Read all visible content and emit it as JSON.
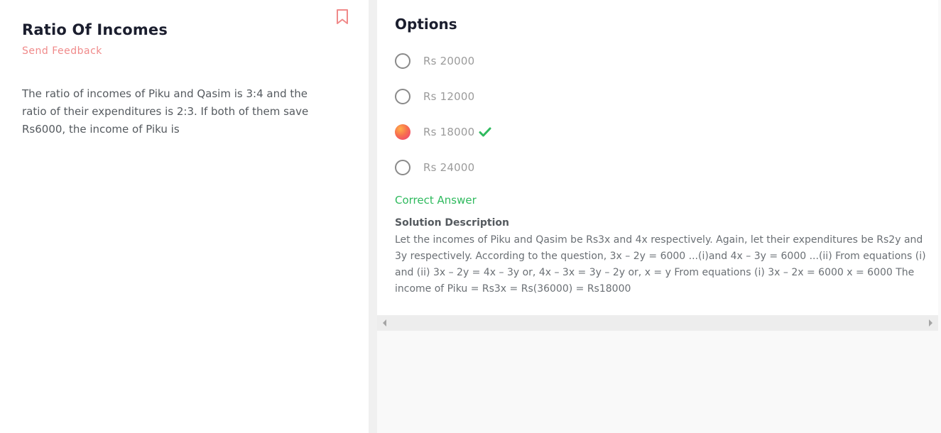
{
  "question": {
    "title": "Ratio Of Incomes",
    "feedback_label": "Send Feedback",
    "text": "The ratio of incomes of Piku and Qasim is 3:4 and the ratio of their expenditures is 2:3. If both of them save Rs6000, the income of Piku is"
  },
  "options": {
    "title": "Options",
    "items": [
      {
        "label": "Rs 20000",
        "selected": false,
        "correct": false
      },
      {
        "label": "Rs 12000",
        "selected": false,
        "correct": false
      },
      {
        "label": "Rs 18000",
        "selected": true,
        "correct": true
      },
      {
        "label": "Rs 24000",
        "selected": false,
        "correct": false
      }
    ]
  },
  "result": {
    "label": "Correct Answer"
  },
  "solution": {
    "heading": "Solution Description",
    "text": "Let the incomes of Piku and Qasim be Rs3x and 4x respectively. Again, let their expenditures be Rs2y and 3y respectively. According to the question, 3x – 2y = 6000 ...(i)and 4x – 3y = 6000 ...(ii) From equations (i) and (ii) 3x – 2y = 4x – 3y or, 4x – 3x = 3y – 2y or, x = y From equations (i) 3x – 2x = 6000 x = 6000 The income of Piku = Rs3x = Rs(36000) = Rs18000"
  },
  "icons": {
    "bookmark": "bookmark-icon",
    "check": "check-icon"
  },
  "colors": {
    "accent": "#f08a8a",
    "correct": "#2fba5e",
    "title": "#1b1e2e"
  }
}
